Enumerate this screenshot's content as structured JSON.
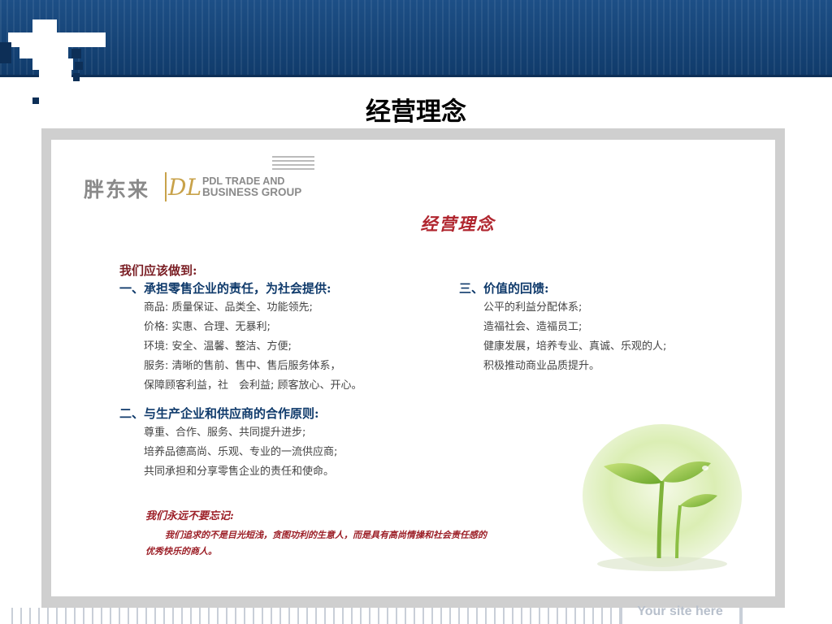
{
  "slide": {
    "title": "经营理念"
  },
  "logo": {
    "cn_name": "胖东来",
    "mark": "DL",
    "en_line1": "PDL TRADE AND",
    "en_line2": "BUSINESS GROUP"
  },
  "content": {
    "title": "经营理念",
    "intro": "我们应该做到:",
    "section1": {
      "heading": "一、承担零售企业的责任，为社会提供:",
      "items": [
        "商品: 质量保证、品类全、功能领先;",
        "价格: 实惠、合理、无暴利;",
        "环境: 安全、温馨、整洁、方便;",
        "服务: 清晰的售前、售中、售后服务体系，",
        "保障顾客利益，社　会利益; 顾客放心、开心。"
      ]
    },
    "section2": {
      "heading": "二、与生产企业和供应商的合作原则:",
      "items": [
        "尊重、合作、服务、共同提升进步;",
        "培养品德高尚、乐观、专业的一流供应商;",
        "共同承担和分享零售企业的责任和使命。"
      ]
    },
    "section3": {
      "heading": "三、价值的回馈:",
      "items": [
        "公平的利益分配体系;",
        "造福社会、造福员工;",
        "健康发展，培养专业、真诚、乐观的人;",
        "积极推动商业品质提升。"
      ]
    },
    "reminder": {
      "title": "我们永远不要忘记:",
      "body": "我们追求的不是目光短浅，贪图功利的生意人，而是具有高尚情操和社会责任感的优秀快乐的商人。"
    }
  },
  "footer": {
    "site": "Your site here"
  },
  "colors": {
    "header": "#1d4f86",
    "accent_red": "#b0252e",
    "heading_blue": "#0f3a6b",
    "frame_gray": "#cfcfcf"
  }
}
